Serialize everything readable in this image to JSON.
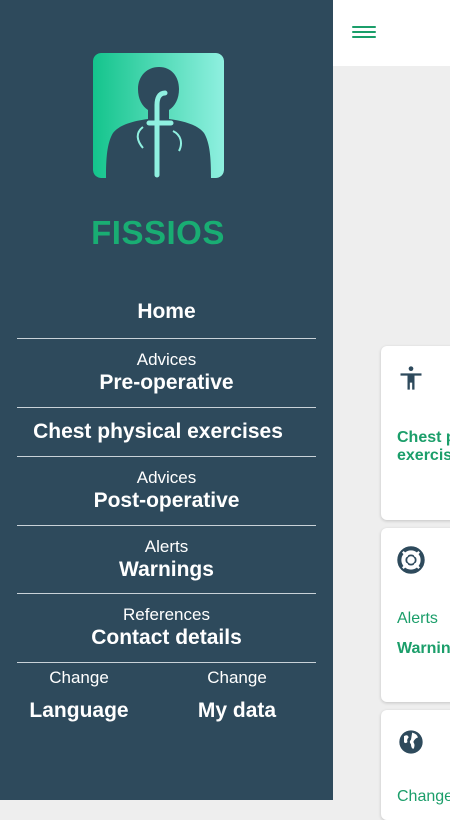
{
  "app": {
    "name": "FISSIOS"
  },
  "colors": {
    "accent": "#1b9e6a",
    "drawer_bg": "#2e4a5c",
    "logo_gradient_start": "#14c48c",
    "logo_gradient_end": "#8ff0e0"
  },
  "drawer": {
    "items": [
      {
        "label": "Home"
      },
      {
        "small": "Advices",
        "label": "Pre-operative"
      },
      {
        "label": "Chest physical exercises"
      },
      {
        "small": "Advices",
        "label": "Post-operative"
      },
      {
        "small": "Alerts",
        "label": "Warnings"
      },
      {
        "small": "References",
        "label": "Contact details"
      }
    ],
    "bottom": [
      {
        "small": "Change",
        "label": "Language"
      },
      {
        "small": "Change",
        "label": "My data"
      }
    ]
  },
  "main": {
    "cards": [
      {
        "icon": "accessibility-icon",
        "title_line1": "Chest p",
        "title_line2": "exercis"
      },
      {
        "icon": "lifebuoy-icon",
        "subtitle": "Alerts",
        "title": "Warnin"
      },
      {
        "icon": "globe-icon",
        "subtitle": "Change"
      }
    ]
  }
}
